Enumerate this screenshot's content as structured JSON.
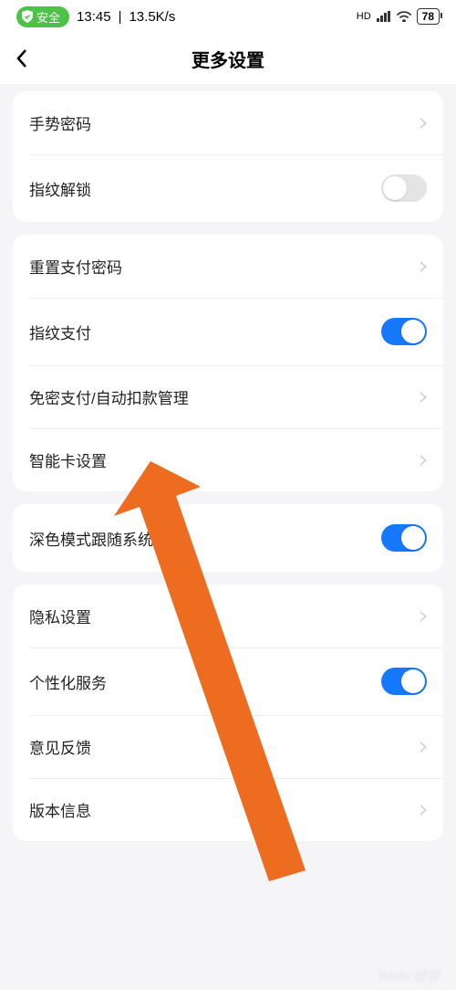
{
  "status": {
    "safe_label": "安全",
    "time": "13:45",
    "speed": "13.5K/s",
    "hd": "HD",
    "battery": "78"
  },
  "header": {
    "title": "更多设置"
  },
  "groups": [
    {
      "rows": [
        {
          "label": "手势密码",
          "type": "chevron"
        },
        {
          "label": "指纹解锁",
          "type": "toggle",
          "on": false
        }
      ]
    },
    {
      "rows": [
        {
          "label": "重置支付密码",
          "type": "chevron"
        },
        {
          "label": "指纹支付",
          "type": "toggle",
          "on": true
        },
        {
          "label": "免密支付/自动扣款管理",
          "type": "chevron"
        },
        {
          "label": "智能卡设置",
          "type": "chevron"
        }
      ]
    },
    {
      "rows": [
        {
          "label": "深色模式跟随系统设置",
          "type": "toggle",
          "on": true
        }
      ]
    },
    {
      "rows": [
        {
          "label": "隐私设置",
          "type": "chevron"
        },
        {
          "label": "个性化服务",
          "type": "toggle",
          "on": true
        },
        {
          "label": "意见反馈",
          "type": "chevron"
        },
        {
          "label": "版本信息",
          "type": "chevron"
        }
      ]
    }
  ],
  "watermark": "Baidu 经验"
}
